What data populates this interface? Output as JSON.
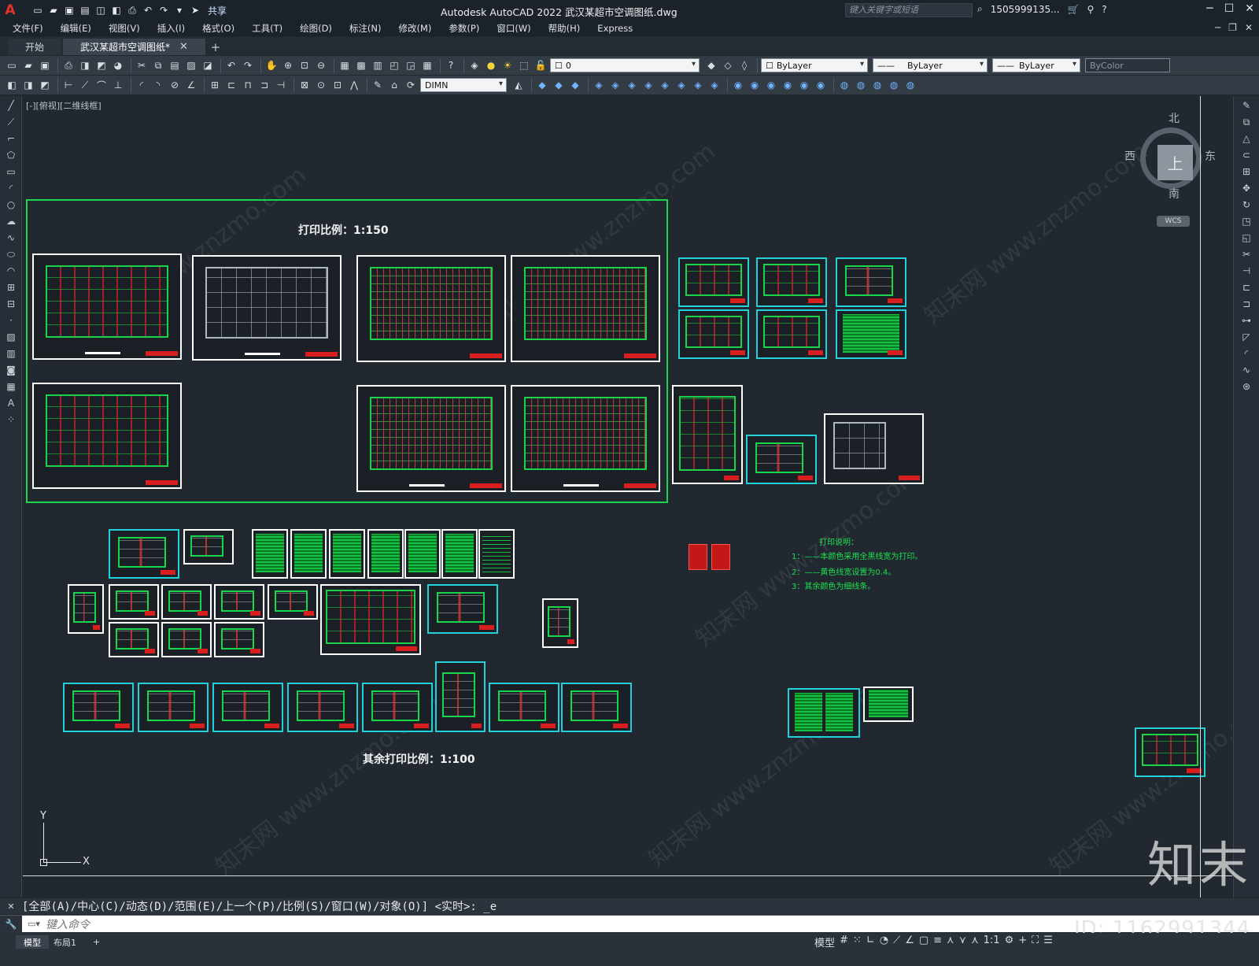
{
  "app": {
    "title": "Autodesk AutoCAD 2022    武汉某超市空调图纸.dwg",
    "share": "共享",
    "search_placeholder": "键入关键字或短语",
    "user": "1505999135..."
  },
  "menu": [
    "文件(F)",
    "编辑(E)",
    "视图(V)",
    "插入(I)",
    "格式(O)",
    "工具(T)",
    "绘图(D)",
    "标注(N)",
    "修改(M)",
    "参数(P)",
    "窗口(W)",
    "帮助(H)",
    "Express"
  ],
  "tabs": [
    {
      "label": "开始"
    },
    {
      "label": "武汉某超市空调图纸*"
    }
  ],
  "toolbar": {
    "layer": "0",
    "color": "ByLayer",
    "linetype": "ByLayer",
    "lineweight": "ByLayer",
    "plotstyle": "ByColor",
    "dimstyle": "DIMN"
  },
  "viewport": {
    "label": "[-][俯视][二维线框]",
    "compass": {
      "north": "北",
      "south": "南",
      "east": "东",
      "west": "西",
      "face": "上"
    },
    "wcs": "WCS",
    "text_scale_main": "打印比例：1:150",
    "text_scale_other": "其余打印比例：1:100",
    "notes_title": "打印说明：",
    "notes": [
      "1：——本颜色采用全黑线宽为打印。",
      "2：——黄色线宽设置为0.4。",
      "3：其余颜色为细线条。"
    ],
    "ucs_x": "X",
    "ucs_y": "Y",
    "watermark": "知末网 www.znzmo.com"
  },
  "command": {
    "history": "[全部(A)/中心(C)/动态(D)/范围(E)/上一个(P)/比例(S)/窗口(W)/对象(O)] <实时>: _e",
    "placeholder": "键入命令"
  },
  "status": {
    "tabs": [
      "模型",
      "布局1"
    ],
    "model_label": "模型",
    "scale": "1:1"
  },
  "brand": {
    "logo": "知末",
    "id": "ID: 1162991344"
  }
}
